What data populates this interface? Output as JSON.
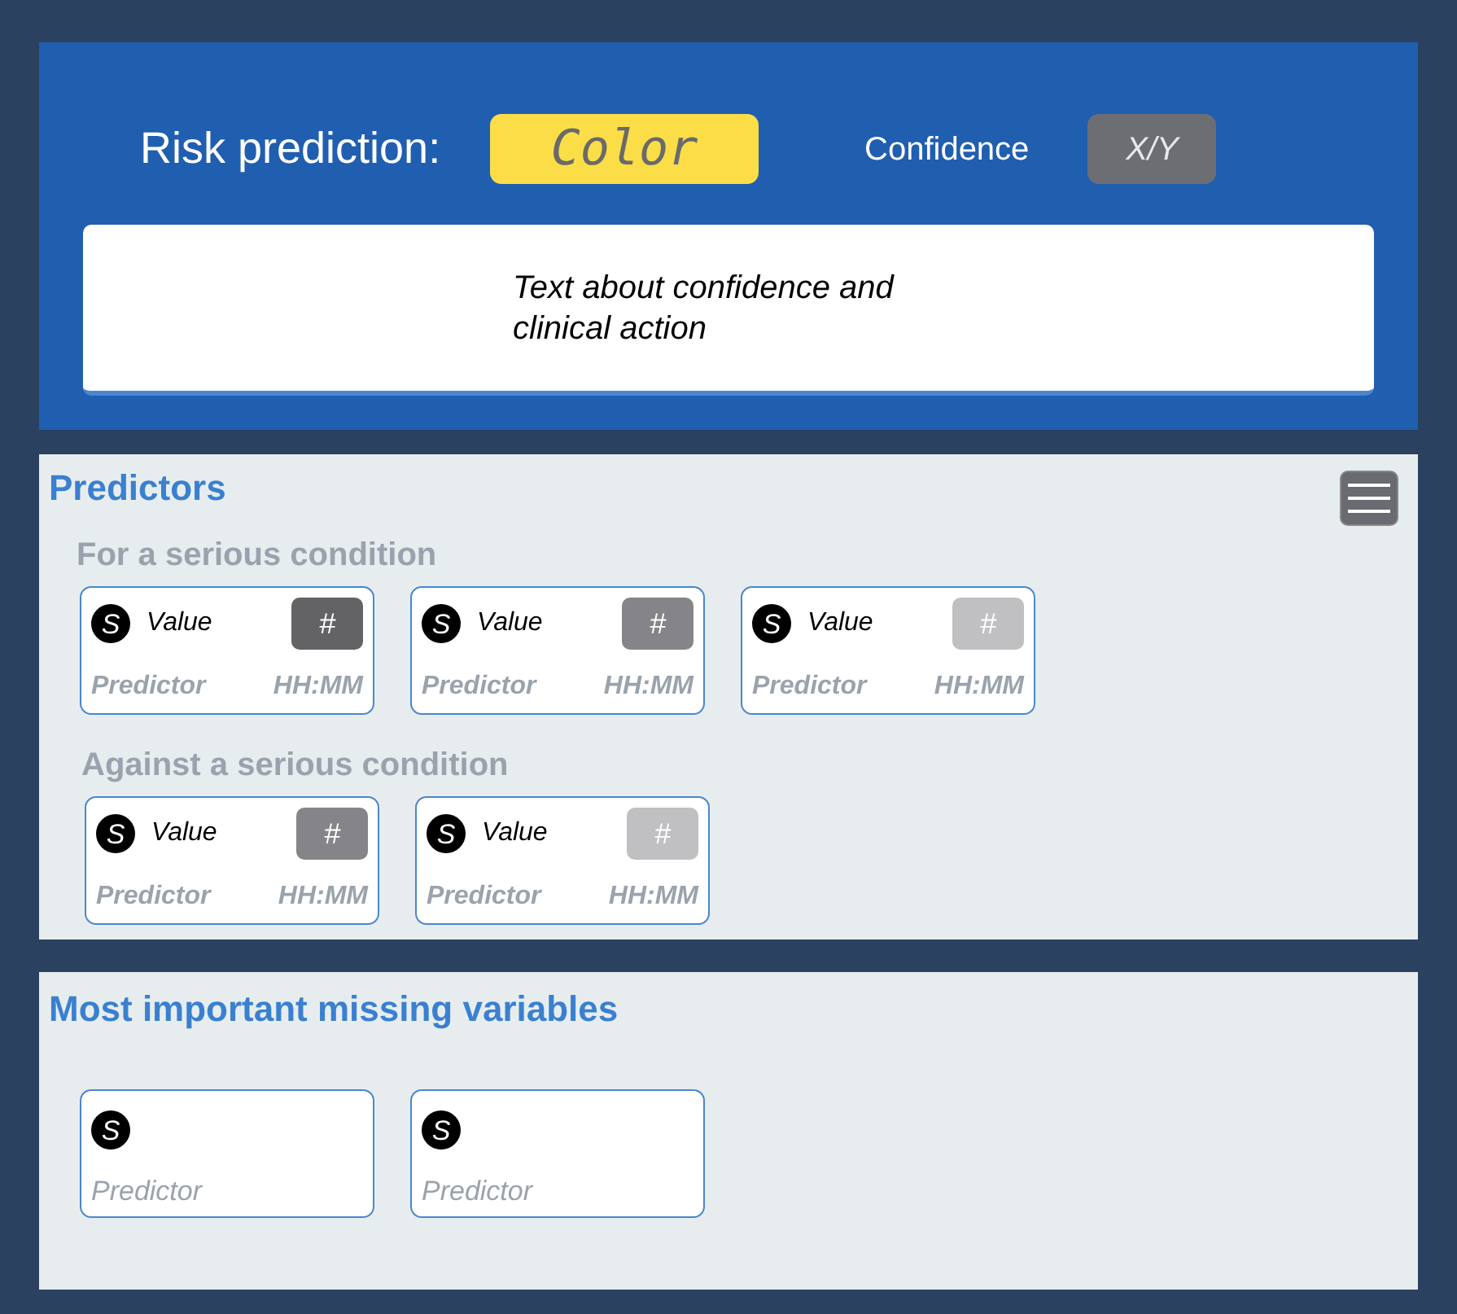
{
  "header": {
    "title": "Risk prediction:",
    "prediction": "Color",
    "confidence_label": "Confidence",
    "confidence_value": "X/Y",
    "note": "Text about confidence and clinical action"
  },
  "predictors": {
    "title": "Predictors",
    "groups": [
      {
        "title": "For a serious condition",
        "cards": [
          {
            "symbol": "S",
            "value": "Value",
            "badge": "#",
            "color": "#636366",
            "predictor": "Predictor",
            "time": "HH:MM"
          },
          {
            "symbol": "S",
            "value": "Value",
            "badge": "#",
            "color": "#858589",
            "predictor": "Predictor",
            "time": "HH:MM"
          },
          {
            "symbol": "S",
            "value": "Value",
            "badge": "#",
            "color": "#c0c0c2",
            "predictor": "Predictor",
            "time": "HH:MM"
          }
        ]
      },
      {
        "title": "Against a serious condition",
        "cards": [
          {
            "symbol": "S",
            "value": "Value",
            "badge": "#",
            "color": "#858589",
            "predictor": "Predictor",
            "time": "HH:MM"
          },
          {
            "symbol": "S",
            "value": "Value",
            "badge": "#",
            "color": "#c0c0c2",
            "predictor": "Predictor",
            "time": "HH:MM"
          }
        ]
      }
    ]
  },
  "missing": {
    "title": "Most important missing variables",
    "cards": [
      {
        "symbol": "S",
        "predictor": "Predictor"
      },
      {
        "symbol": "S",
        "predictor": "Predictor"
      }
    ]
  }
}
